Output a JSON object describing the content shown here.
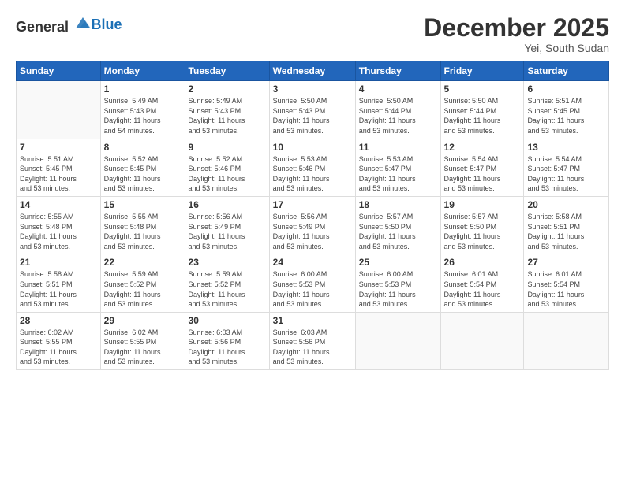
{
  "logo": {
    "general": "General",
    "blue": "Blue"
  },
  "title": "December 2025",
  "subtitle": "Yei, South Sudan",
  "header_days": [
    "Sunday",
    "Monday",
    "Tuesday",
    "Wednesday",
    "Thursday",
    "Friday",
    "Saturday"
  ],
  "weeks": [
    [
      {
        "day": "",
        "info": ""
      },
      {
        "day": "1",
        "info": "Sunrise: 5:49 AM\nSunset: 5:43 PM\nDaylight: 11 hours\nand 54 minutes."
      },
      {
        "day": "2",
        "info": "Sunrise: 5:49 AM\nSunset: 5:43 PM\nDaylight: 11 hours\nand 53 minutes."
      },
      {
        "day": "3",
        "info": "Sunrise: 5:50 AM\nSunset: 5:43 PM\nDaylight: 11 hours\nand 53 minutes."
      },
      {
        "day": "4",
        "info": "Sunrise: 5:50 AM\nSunset: 5:44 PM\nDaylight: 11 hours\nand 53 minutes."
      },
      {
        "day": "5",
        "info": "Sunrise: 5:50 AM\nSunset: 5:44 PM\nDaylight: 11 hours\nand 53 minutes."
      },
      {
        "day": "6",
        "info": "Sunrise: 5:51 AM\nSunset: 5:45 PM\nDaylight: 11 hours\nand 53 minutes."
      }
    ],
    [
      {
        "day": "7",
        "info": "Sunrise: 5:51 AM\nSunset: 5:45 PM\nDaylight: 11 hours\nand 53 minutes."
      },
      {
        "day": "8",
        "info": "Sunrise: 5:52 AM\nSunset: 5:45 PM\nDaylight: 11 hours\nand 53 minutes."
      },
      {
        "day": "9",
        "info": "Sunrise: 5:52 AM\nSunset: 5:46 PM\nDaylight: 11 hours\nand 53 minutes."
      },
      {
        "day": "10",
        "info": "Sunrise: 5:53 AM\nSunset: 5:46 PM\nDaylight: 11 hours\nand 53 minutes."
      },
      {
        "day": "11",
        "info": "Sunrise: 5:53 AM\nSunset: 5:47 PM\nDaylight: 11 hours\nand 53 minutes."
      },
      {
        "day": "12",
        "info": "Sunrise: 5:54 AM\nSunset: 5:47 PM\nDaylight: 11 hours\nand 53 minutes."
      },
      {
        "day": "13",
        "info": "Sunrise: 5:54 AM\nSunset: 5:47 PM\nDaylight: 11 hours\nand 53 minutes."
      }
    ],
    [
      {
        "day": "14",
        "info": "Sunrise: 5:55 AM\nSunset: 5:48 PM\nDaylight: 11 hours\nand 53 minutes."
      },
      {
        "day": "15",
        "info": "Sunrise: 5:55 AM\nSunset: 5:48 PM\nDaylight: 11 hours\nand 53 minutes."
      },
      {
        "day": "16",
        "info": "Sunrise: 5:56 AM\nSunset: 5:49 PM\nDaylight: 11 hours\nand 53 minutes."
      },
      {
        "day": "17",
        "info": "Sunrise: 5:56 AM\nSunset: 5:49 PM\nDaylight: 11 hours\nand 53 minutes."
      },
      {
        "day": "18",
        "info": "Sunrise: 5:57 AM\nSunset: 5:50 PM\nDaylight: 11 hours\nand 53 minutes."
      },
      {
        "day": "19",
        "info": "Sunrise: 5:57 AM\nSunset: 5:50 PM\nDaylight: 11 hours\nand 53 minutes."
      },
      {
        "day": "20",
        "info": "Sunrise: 5:58 AM\nSunset: 5:51 PM\nDaylight: 11 hours\nand 53 minutes."
      }
    ],
    [
      {
        "day": "21",
        "info": "Sunrise: 5:58 AM\nSunset: 5:51 PM\nDaylight: 11 hours\nand 53 minutes."
      },
      {
        "day": "22",
        "info": "Sunrise: 5:59 AM\nSunset: 5:52 PM\nDaylight: 11 hours\nand 53 minutes."
      },
      {
        "day": "23",
        "info": "Sunrise: 5:59 AM\nSunset: 5:52 PM\nDaylight: 11 hours\nand 53 minutes."
      },
      {
        "day": "24",
        "info": "Sunrise: 6:00 AM\nSunset: 5:53 PM\nDaylight: 11 hours\nand 53 minutes."
      },
      {
        "day": "25",
        "info": "Sunrise: 6:00 AM\nSunset: 5:53 PM\nDaylight: 11 hours\nand 53 minutes."
      },
      {
        "day": "26",
        "info": "Sunrise: 6:01 AM\nSunset: 5:54 PM\nDaylight: 11 hours\nand 53 minutes."
      },
      {
        "day": "27",
        "info": "Sunrise: 6:01 AM\nSunset: 5:54 PM\nDaylight: 11 hours\nand 53 minutes."
      }
    ],
    [
      {
        "day": "28",
        "info": "Sunrise: 6:02 AM\nSunset: 5:55 PM\nDaylight: 11 hours\nand 53 minutes."
      },
      {
        "day": "29",
        "info": "Sunrise: 6:02 AM\nSunset: 5:55 PM\nDaylight: 11 hours\nand 53 minutes."
      },
      {
        "day": "30",
        "info": "Sunrise: 6:03 AM\nSunset: 5:56 PM\nDaylight: 11 hours\nand 53 minutes."
      },
      {
        "day": "31",
        "info": "Sunrise: 6:03 AM\nSunset: 5:56 PM\nDaylight: 11 hours\nand 53 minutes."
      },
      {
        "day": "",
        "info": ""
      },
      {
        "day": "",
        "info": ""
      },
      {
        "day": "",
        "info": ""
      }
    ]
  ]
}
